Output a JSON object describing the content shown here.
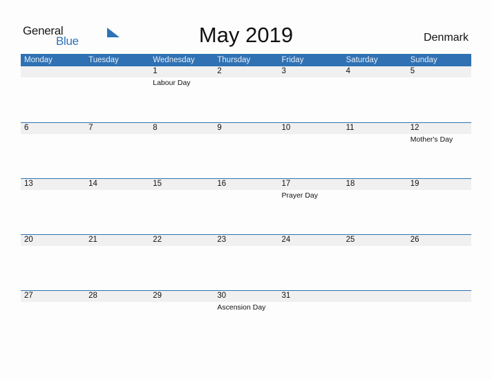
{
  "logo": {
    "general": "General",
    "blue": "Blue",
    "accent": "#2e72b8"
  },
  "title": "May 2019",
  "country": "Denmark",
  "colors": {
    "header_bg": "#2f71b3",
    "band_bg": "#f0f0f0"
  },
  "weekdays": [
    "Monday",
    "Tuesday",
    "Wednesday",
    "Thursday",
    "Friday",
    "Saturday",
    "Sunday"
  ],
  "weeks": [
    [
      {
        "day": "",
        "holiday": ""
      },
      {
        "day": "",
        "holiday": ""
      },
      {
        "day": "1",
        "holiday": "Labour Day"
      },
      {
        "day": "2",
        "holiday": ""
      },
      {
        "day": "3",
        "holiday": ""
      },
      {
        "day": "4",
        "holiday": ""
      },
      {
        "day": "5",
        "holiday": ""
      }
    ],
    [
      {
        "day": "6",
        "holiday": ""
      },
      {
        "day": "7",
        "holiday": ""
      },
      {
        "day": "8",
        "holiday": ""
      },
      {
        "day": "9",
        "holiday": ""
      },
      {
        "day": "10",
        "holiday": ""
      },
      {
        "day": "11",
        "holiday": ""
      },
      {
        "day": "12",
        "holiday": "Mother's Day"
      }
    ],
    [
      {
        "day": "13",
        "holiday": ""
      },
      {
        "day": "14",
        "holiday": ""
      },
      {
        "day": "15",
        "holiday": ""
      },
      {
        "day": "16",
        "holiday": ""
      },
      {
        "day": "17",
        "holiday": "Prayer Day"
      },
      {
        "day": "18",
        "holiday": ""
      },
      {
        "day": "19",
        "holiday": ""
      }
    ],
    [
      {
        "day": "20",
        "holiday": ""
      },
      {
        "day": "21",
        "holiday": ""
      },
      {
        "day": "22",
        "holiday": ""
      },
      {
        "day": "23",
        "holiday": ""
      },
      {
        "day": "24",
        "holiday": ""
      },
      {
        "day": "25",
        "holiday": ""
      },
      {
        "day": "26",
        "holiday": ""
      }
    ],
    [
      {
        "day": "27",
        "holiday": ""
      },
      {
        "day": "28",
        "holiday": ""
      },
      {
        "day": "29",
        "holiday": ""
      },
      {
        "day": "30",
        "holiday": "Ascension Day"
      },
      {
        "day": "31",
        "holiday": ""
      },
      {
        "day": "",
        "holiday": ""
      },
      {
        "day": "",
        "holiday": ""
      }
    ]
  ]
}
